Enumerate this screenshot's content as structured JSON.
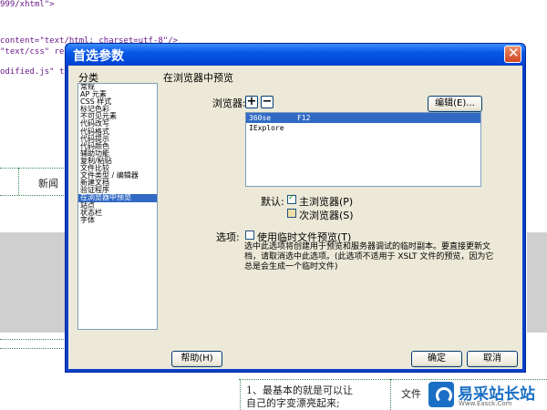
{
  "background": {
    "code_lines": [
      "999/xhtml\">",
      "content=\"text/html; charset=utf-8\"/>",
      "\"text/css\" re",
      "odified.js\" ty"
    ],
    "tab_text": "新闻",
    "content_lines": [
      "1、最基本的就是可以让",
      "自己的字变漂亮起来;"
    ],
    "right_text": "文件"
  },
  "watermark": {
    "title": "易采站长站",
    "subtitle": "Www.Easck.Com"
  },
  "dialog": {
    "title": "首选参数",
    "close_glyph": "✕",
    "category_label": "分类",
    "categories": [
      "常规",
      "AP 元素",
      "CSS 样式",
      "标记色彩",
      "不可见元素",
      "代码改写",
      "代码格式",
      "代码提示",
      "代码颜色",
      "辅助功能",
      "复制/粘贴",
      "文件比较",
      "文件类型 / 编辑器",
      "新建文档",
      "验证程序",
      "在浏览器中预览",
      "站点",
      "状态栏",
      "字体"
    ],
    "selected_category": "在浏览器中预览",
    "section_title": "在浏览器中预览",
    "browsers_label": "浏览器:",
    "add_glyph": "+",
    "remove_glyph": "−",
    "edit_button": "编辑(E)...",
    "browsers": [
      "360se      F12",
      "IExplore"
    ],
    "default_label": "默认:",
    "primary_browser": "主浏览器(P)",
    "secondary_browser": "次浏览器(S)",
    "options_label": "选项:",
    "temp_file_option": "使用临时文件预览(T)",
    "description": "选中此选项将创建用于预览和服务器调试的临时副本。要直接更新文档，请取消选中此选项。(此选项不适用于 XSLT 文件的预览，因为它总是会生成一个临时文件)",
    "help_button": "帮助(H)",
    "ok_button": "确定",
    "cancel_button": "取消"
  }
}
